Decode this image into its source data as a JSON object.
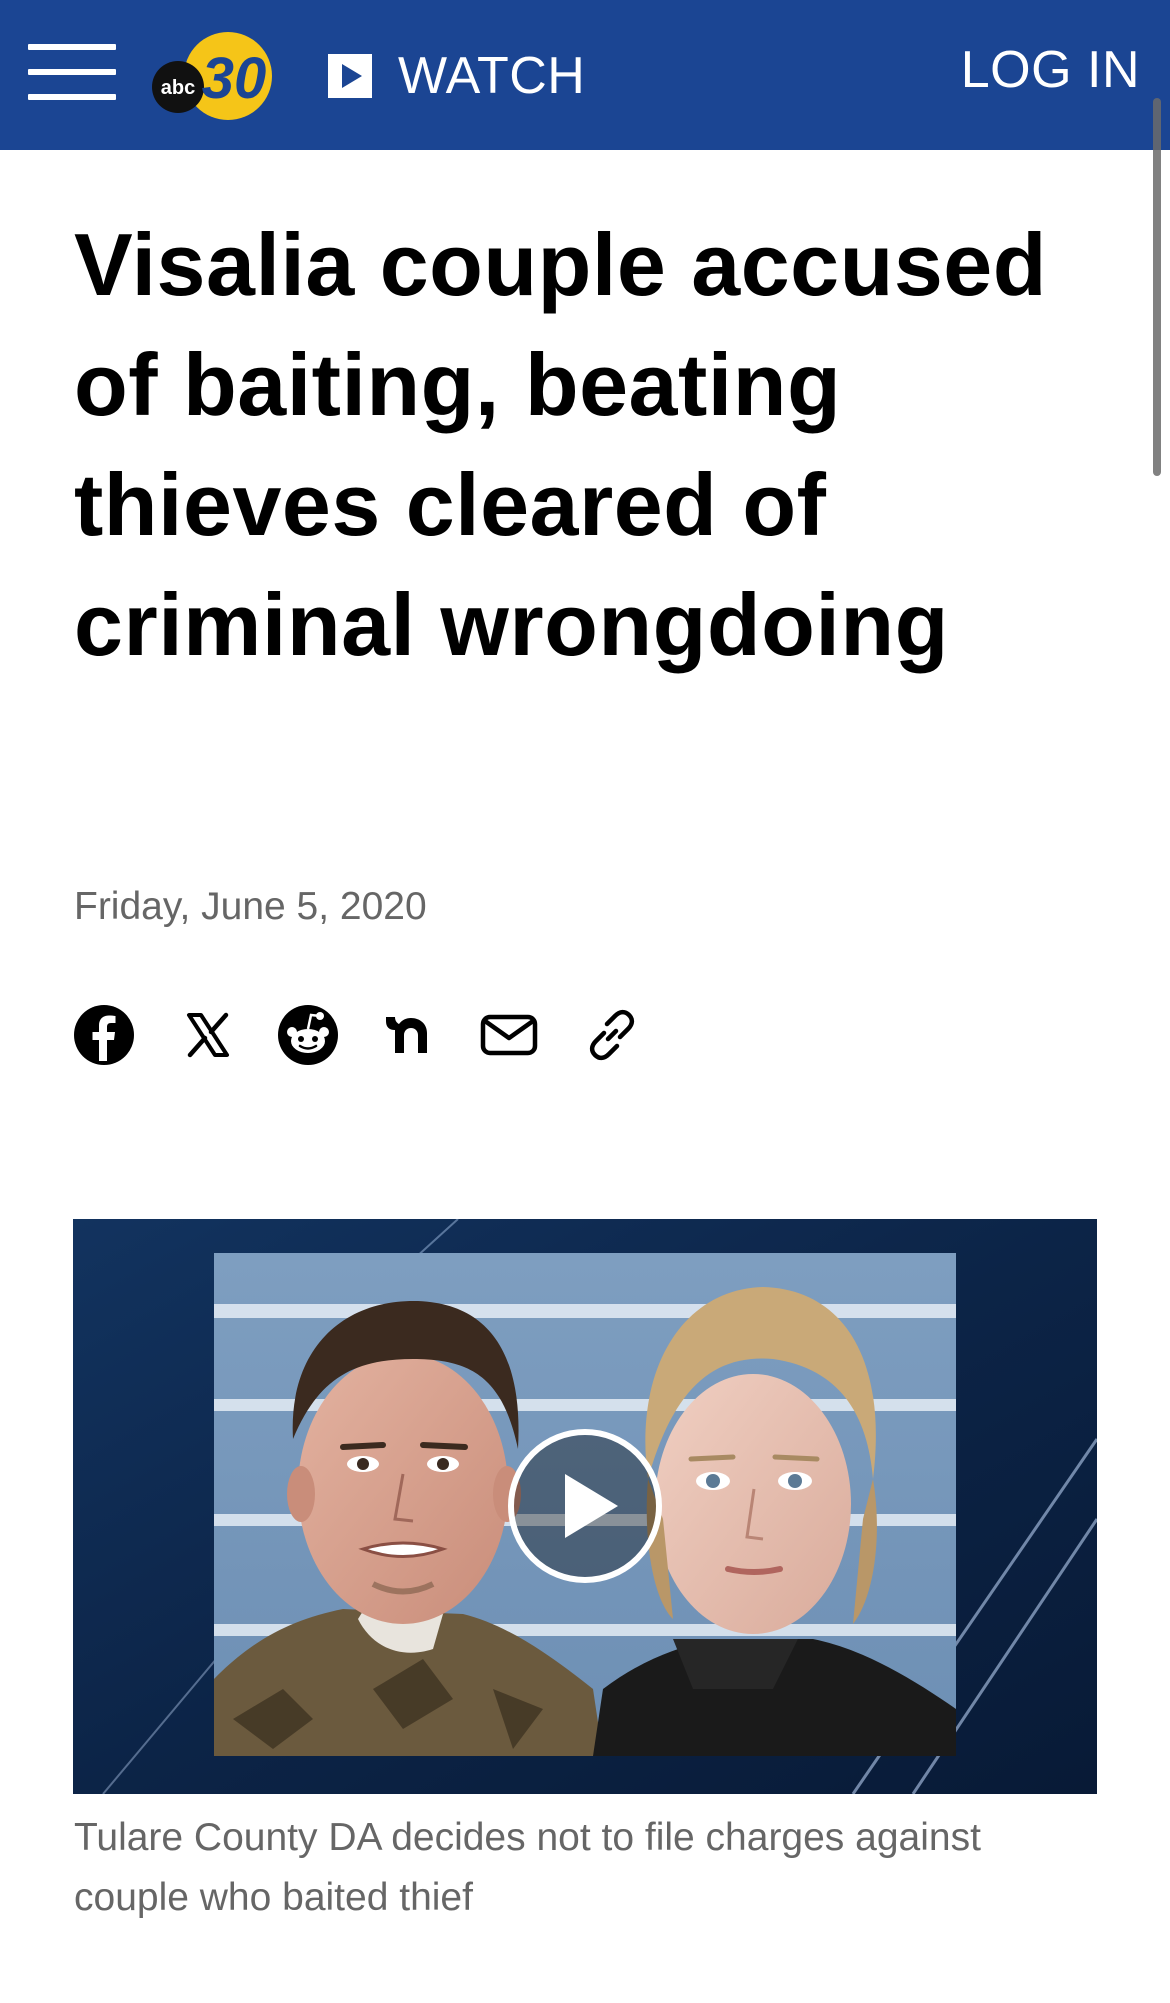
{
  "header": {
    "logo_text": "abc 30",
    "watch_label": "WATCH",
    "login_label": "LOG IN",
    "brand_color": "#1b4593"
  },
  "article": {
    "headline": "Visalia couple accused of baiting, beating thieves cleared of criminal wrongdoing",
    "date": "Friday, June 5, 2020",
    "share_icons": [
      "facebook-icon",
      "x-icon",
      "reddit-icon",
      "nextdoor-icon",
      "email-icon",
      "link-icon"
    ],
    "video_caption": "Tulare County DA decides not to file charges against couple who baited thief"
  }
}
